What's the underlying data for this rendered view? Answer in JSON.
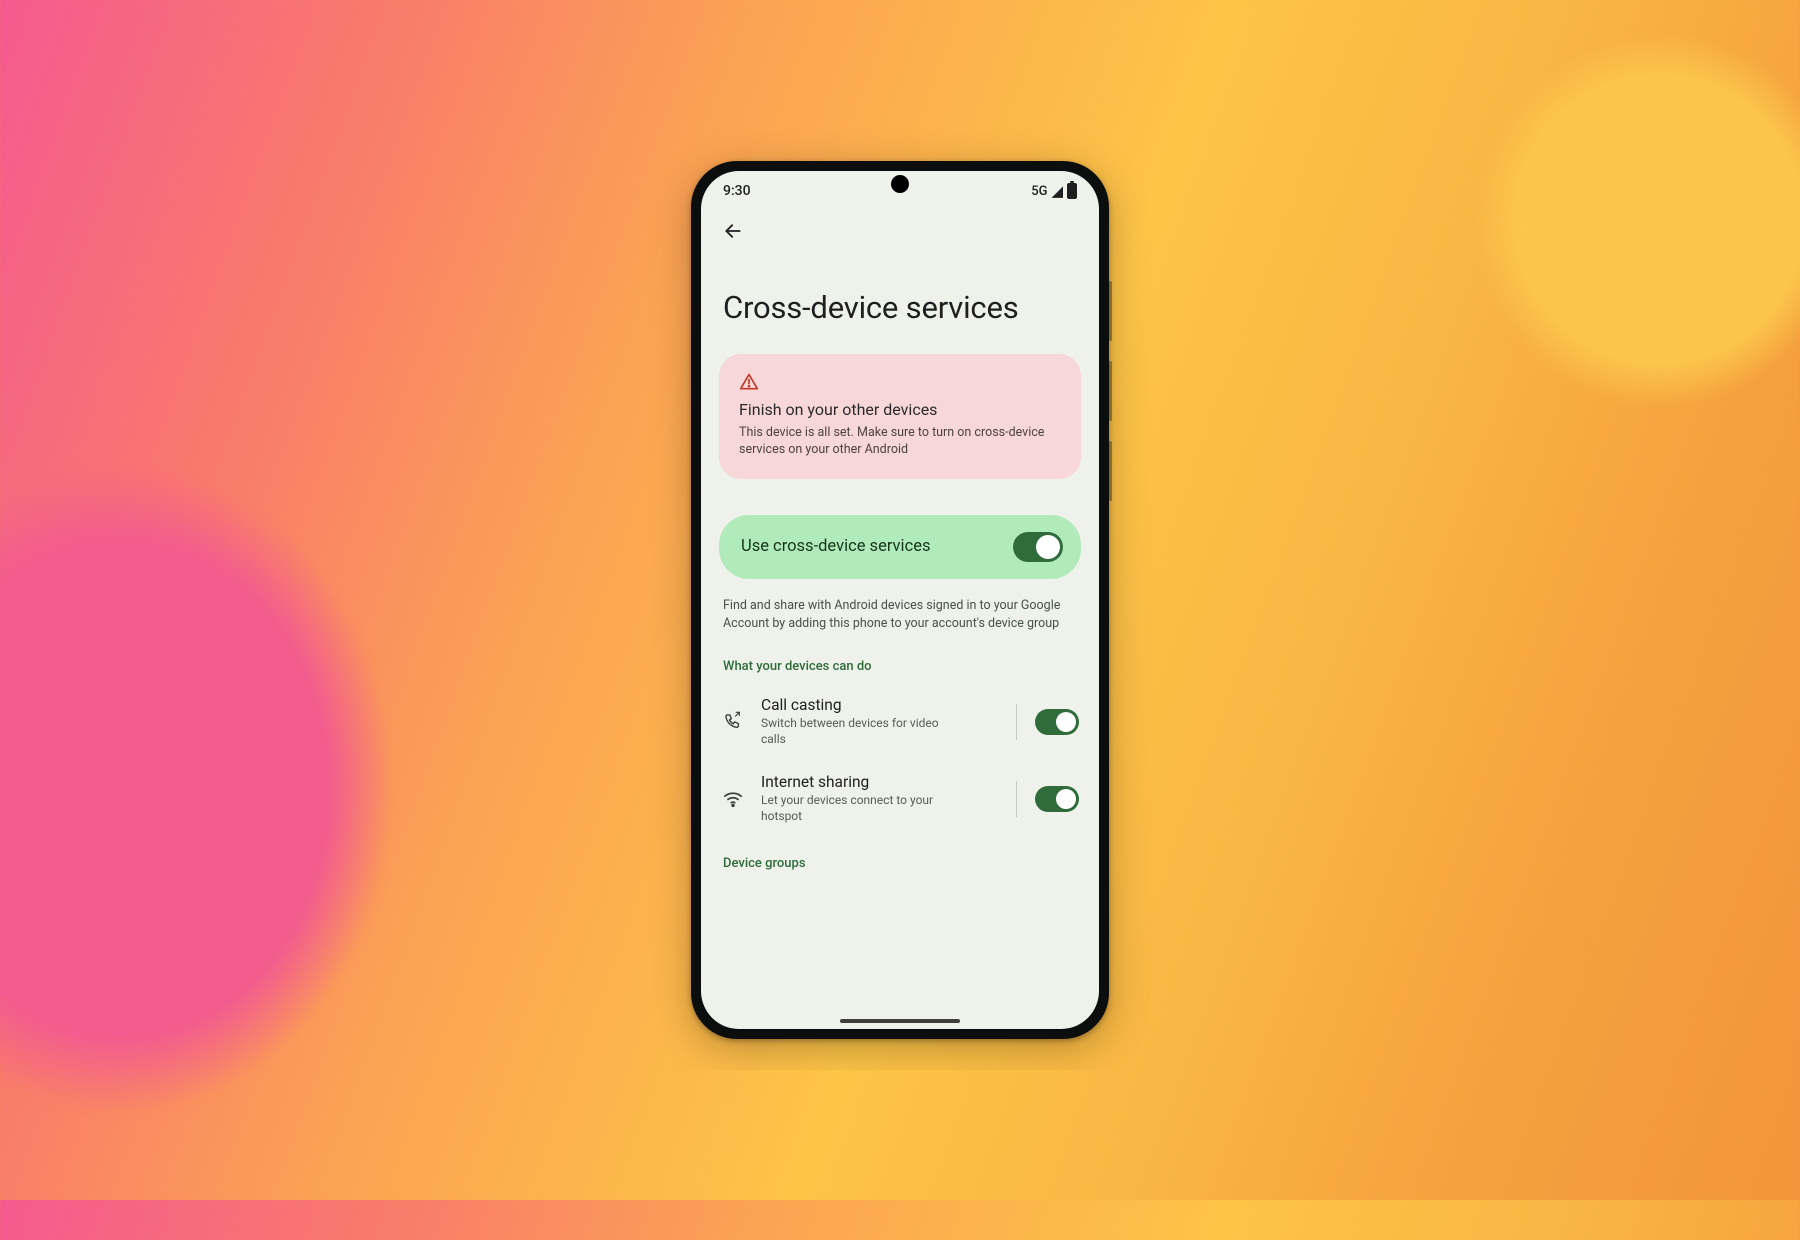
{
  "statusbar": {
    "time": "9:30",
    "network": "5G"
  },
  "page": {
    "title": "Cross-device services"
  },
  "alert": {
    "title": "Finish on your other devices",
    "body": "This device is all set. Make sure to turn on cross-device services on your other Android"
  },
  "main_toggle": {
    "label": "Use cross-device services",
    "on": true
  },
  "description": "Find and share with Android devices signed in to your Google Account by adding this phone to your account's device group",
  "section_label": "What your devices can do",
  "features": {
    "call_casting": {
      "title": "Call casting",
      "sub": "Switch between devices for video calls",
      "on": true
    },
    "internet_sharing": {
      "title": "Internet sharing",
      "sub": "Let your devices connect to your hotspot",
      "on": true
    }
  },
  "footer_label": "Device groups"
}
